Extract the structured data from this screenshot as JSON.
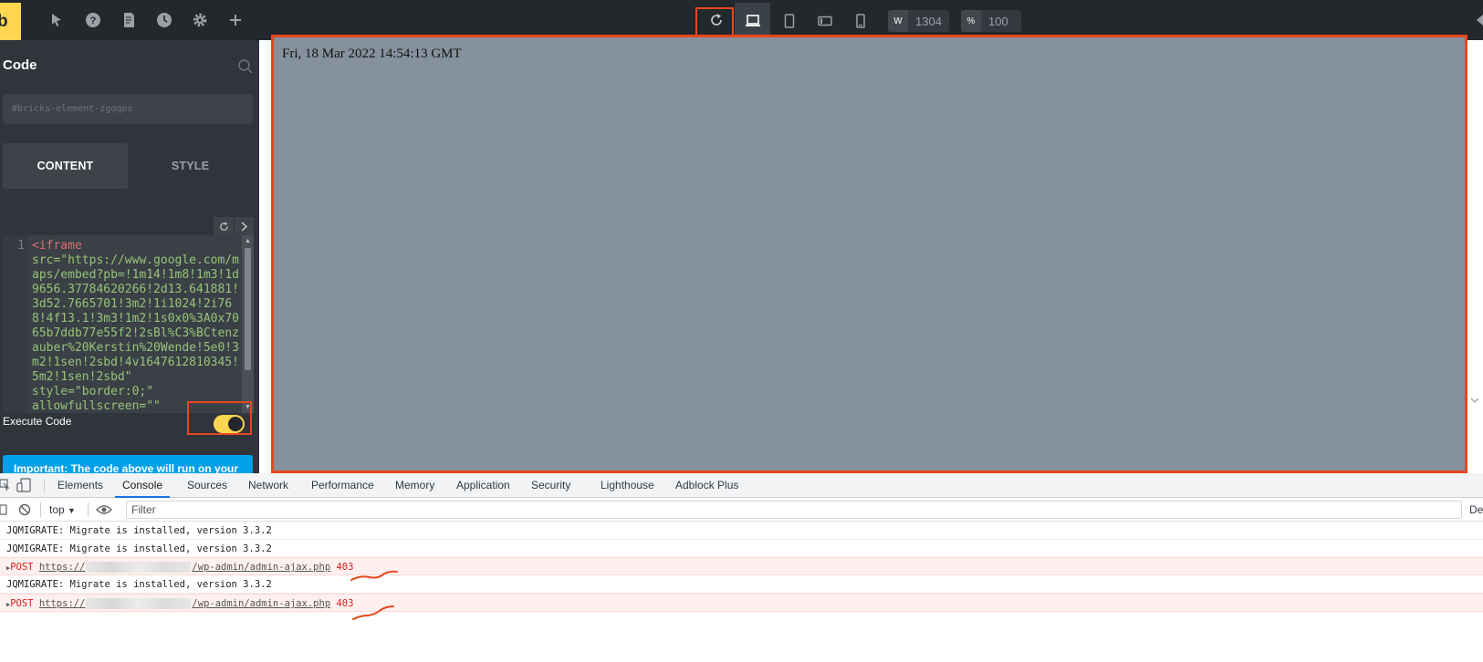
{
  "toolbar": {
    "logo": "b",
    "icons": [
      "cursor-icon",
      "help-icon",
      "page-icon",
      "history-icon",
      "gear-icon",
      "plus-icon"
    ],
    "width_label": "W",
    "width_value": "1304",
    "zoom_label": "%",
    "zoom_value": "100"
  },
  "panel": {
    "title": "Code",
    "selector_placeholder": "#bricks-element-zgqqos",
    "tabs": [
      {
        "label": "CONTENT"
      },
      {
        "label": "STYLE"
      }
    ],
    "code": {
      "line_number": "1",
      "tag": "<iframe",
      "body": "\nsrc=\"https://www.google.com/maps/embed?pb=!1m14!1m8!1m3!1d9656.37784620266!2d13.641881!3d52.7665701!3m2!1i1024!2i768!4f13.1!3m3!1m2!1s0x0%3A0x7065b7ddb77e55f2!2sBl%C3%BCtenzauber%20Kerstin%20Wende!5e0!3m2!1sen!2sbd!4v1647612810345!5m2!1sen!2sbd\"\nstyle=\"border:0;\"\nallowfullscreen=\"\""
    },
    "execute_label": "Execute Code",
    "execute_enabled": true,
    "important_text": "Important: The code above will run on your"
  },
  "canvas": {
    "date_text": "Fri, 18 Mar 2022 14:54:13 GMT",
    "background": "#85919d"
  },
  "devtools": {
    "tabs": [
      "Elements",
      "Console",
      "Sources",
      "Network",
      "Performance",
      "Memory",
      "Application",
      "Security",
      "Lighthouse",
      "Adblock Plus"
    ],
    "active_tab": "Console",
    "context": "top",
    "filter_placeholder": "Filter",
    "levels_label": "De",
    "logs": [
      {
        "type": "info",
        "text": "JQMIGRATE: Migrate is installed, version 3.3.2"
      },
      {
        "type": "info",
        "text": "JQMIGRATE: Migrate is installed, version 3.3.2"
      },
      {
        "type": "error",
        "method": "POST",
        "url_prefix": "https://",
        "url_suffix": "/wp-admin/admin-ajax.php",
        "status": "403"
      },
      {
        "type": "info",
        "text": "JQMIGRATE: Migrate is installed, version 3.3.2"
      },
      {
        "type": "error",
        "method": "POST",
        "url_prefix": "https://",
        "url_suffix": "/wp-admin/admin-ajax.php",
        "status": "403"
      }
    ]
  },
  "colors": {
    "accent_yellow": "#ffd64f",
    "highlight_red": "#e8471c",
    "toolbar_bg": "#23282d",
    "panel_bg": "#2f353b",
    "info_blue": "#00a0e9"
  }
}
